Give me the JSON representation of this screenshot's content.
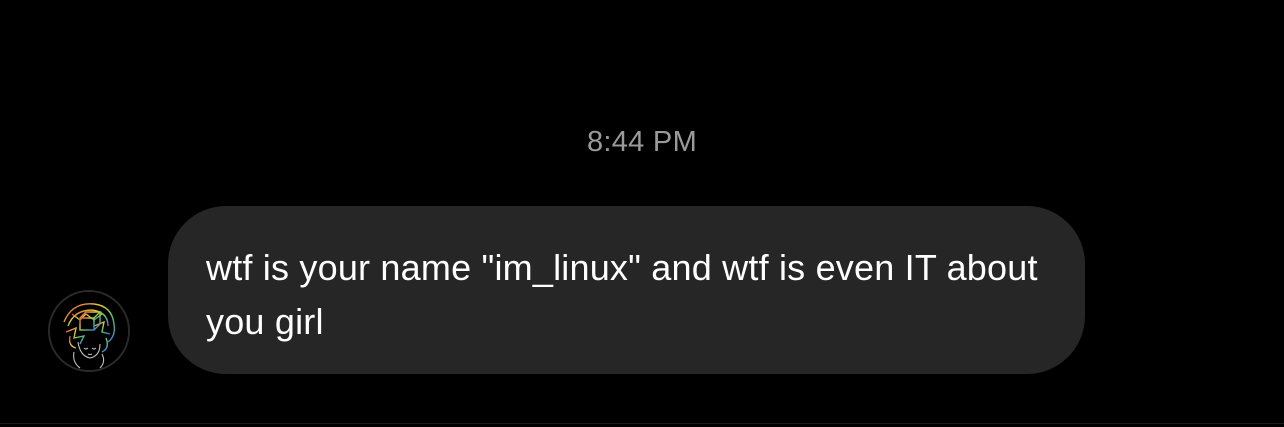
{
  "thread": {
    "timestamp": "8:44 PM",
    "messages": [
      {
        "sender_avatar_icon": "profile-avatar-icon",
        "text": "wtf is your name \"im_linux\" and wtf is even IT about you girl"
      }
    ]
  },
  "colors": {
    "background": "#000000",
    "timestamp_text": "#9a9a9a",
    "bubble_background": "#262626",
    "bubble_text": "#ffffff"
  }
}
